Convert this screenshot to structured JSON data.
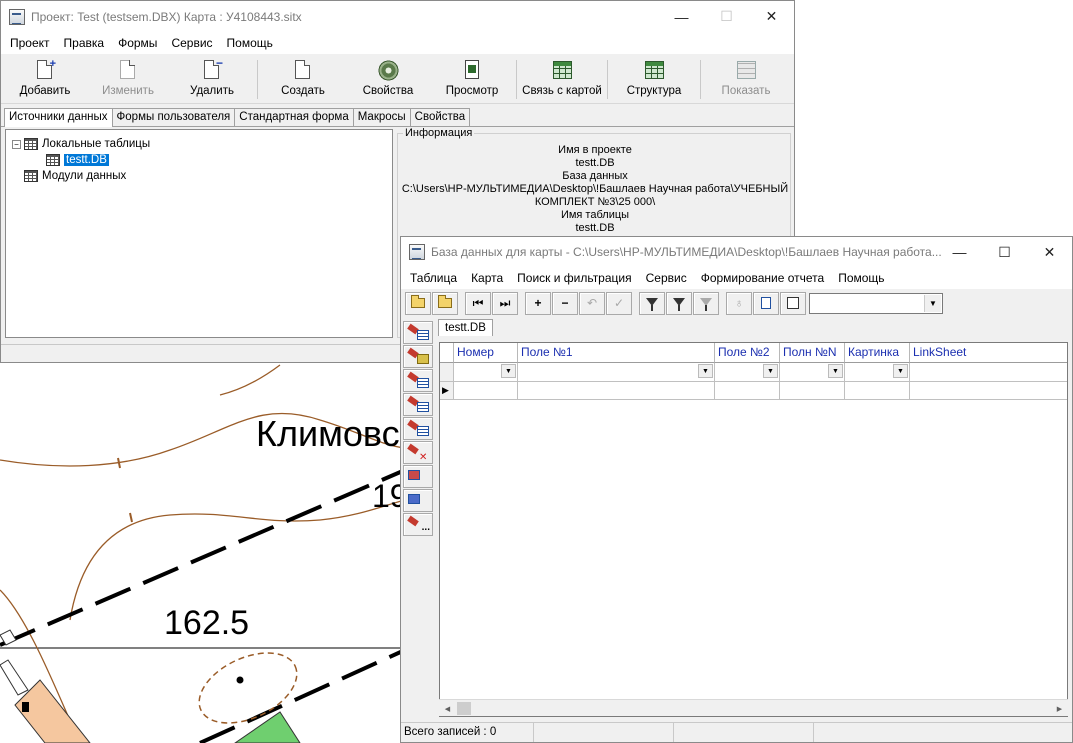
{
  "map": {
    "label_village": "Климовс",
    "label_number": "19",
    "label_elevation": "162.5"
  },
  "project_window": {
    "title": "Проект: Test (testsem.DBX)  Карта : У4108443.sitx",
    "caption_min": "—",
    "caption_max": "☐",
    "caption_close": "✕",
    "menu": [
      "Проект",
      "Правка",
      "Формы",
      "Сервис",
      "Помощь"
    ],
    "toolbar": {
      "add": "Добавить",
      "edit": "Изменить",
      "delete": "Удалить",
      "create": "Создать",
      "properties": "Свойства",
      "preview": "Просмотр",
      "link_map": "Связь с картой",
      "structure": "Структура",
      "show": "Показать"
    },
    "tabs": [
      "Источники данных",
      "Формы пользователя",
      "Стандартная форма",
      "Макросы",
      "Свойства"
    ],
    "tree": {
      "local_tables": "Локальные таблицы",
      "selected_table": "testt.DB",
      "data_modules": "Модули данных",
      "expander": "−"
    },
    "info": {
      "legend": "Информация",
      "lines": [
        "Имя в проекте",
        "testt.DB",
        "База данных",
        "C:\\Users\\HP-МУЛЬТИМЕДИА\\Desktop\\!Башлаев Научная работа\\УЧЕБНЫЙ",
        "КОМПЛЕКТ №3\\25 000\\",
        "Имя таблицы",
        "testt.DB"
      ]
    }
  },
  "db_window": {
    "title": "База данных для карты - C:\\Users\\HP-МУЛЬТИМЕДИА\\Desktop\\!Башлаев Научная работа...",
    "caption_min": "—",
    "caption_max": "☐",
    "caption_close": "✕",
    "menu": [
      "Таблица",
      "Карта",
      "Поиск и фильтрация",
      "Сервис",
      "Формирование отчета",
      "Помощь"
    ],
    "toolbar_glyphs": {
      "first": "⏮",
      "last": "⏭",
      "add_rec": "+",
      "del_rec": "−",
      "undo": "↶",
      "apply": "✓",
      "bulb": "♁"
    },
    "combo_value": "",
    "table_tab": "testt.DB",
    "columns": [
      "Номер",
      "Поле №1",
      "Поле №2",
      "Полн №N",
      "Картинка",
      "LinkSheet"
    ],
    "row_indicator": "▶",
    "dropdown_glyph": "▼",
    "status_total": "Всего записей : 0"
  }
}
